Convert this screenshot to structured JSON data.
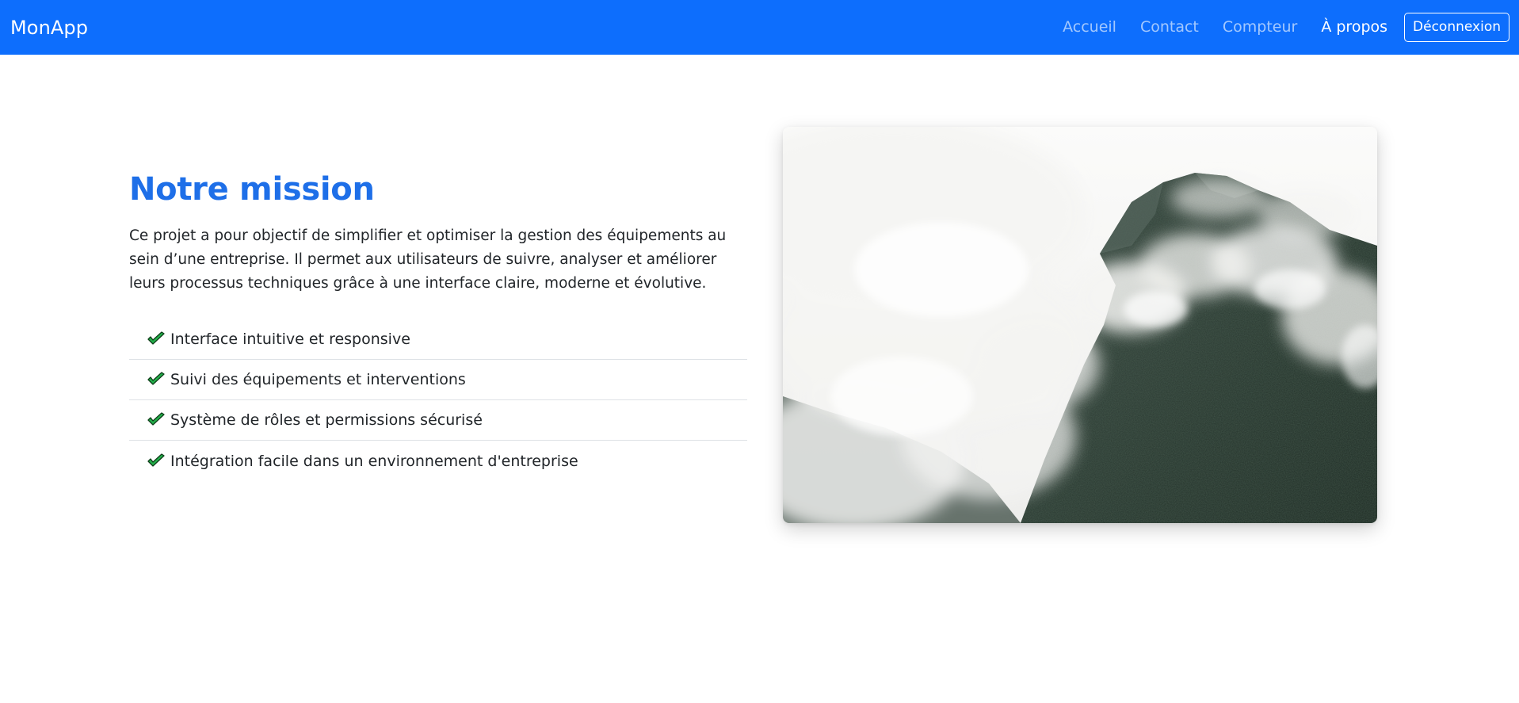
{
  "navbar": {
    "brand": "MonApp",
    "links": [
      {
        "label": "Accueil",
        "active": false
      },
      {
        "label": "Contact",
        "active": false
      },
      {
        "label": "Compteur",
        "active": false
      },
      {
        "label": "À propos",
        "active": true
      }
    ],
    "logout_label": "Déconnexion",
    "background_color": "#0d6efd"
  },
  "mission": {
    "title": "Notre mission",
    "description": "Ce projet a pour objectif de simplifier et optimiser la gestion des équipements au sein d’une entreprise. Il permet aux utilisateurs de suivre, analyser et améliorer leurs processus techniques grâce à une interface claire, moderne et évolutive.",
    "features": [
      {
        "icon": "check-icon",
        "label": "Interface intuitive et responsive"
      },
      {
        "icon": "check-icon",
        "label": "Suivi des équipements et interventions"
      },
      {
        "icon": "check-icon",
        "label": "Système de rôles et permissions sécurisé"
      },
      {
        "icon": "check-icon",
        "label": "Intégration facile dans un environnement d'entreprise"
      }
    ],
    "title_color": "#1e6fe8",
    "check_color": "#22b04a"
  },
  "image": {
    "subject": "misty-forested-mountain"
  }
}
